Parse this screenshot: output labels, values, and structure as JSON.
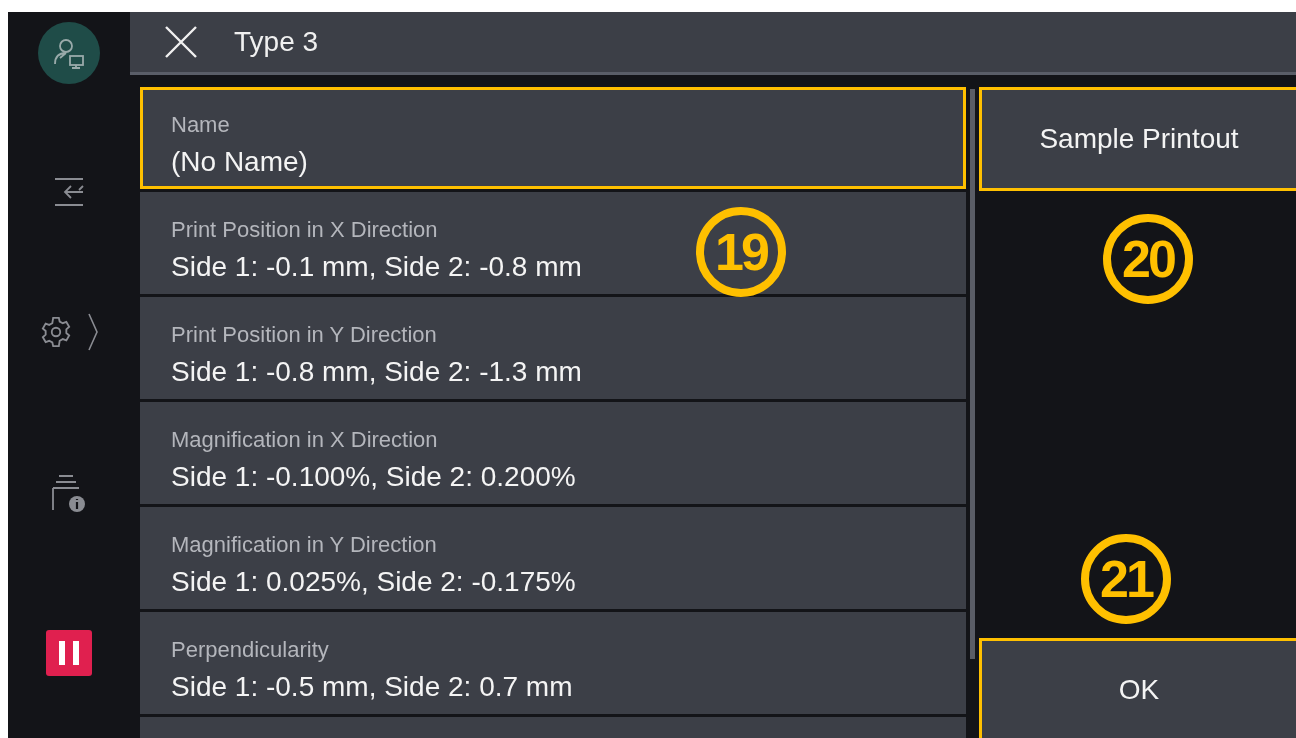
{
  "header": {
    "title": "Type 3"
  },
  "settings": [
    {
      "label": "Name",
      "value": "(No Name)",
      "highlighted": true
    },
    {
      "label": "Print Position in X Direction",
      "value": "Side 1: -0.1 mm, Side 2: -0.8 mm",
      "highlighted": false
    },
    {
      "label": "Print Position in Y Direction",
      "value": "Side 1: -0.8 mm, Side 2: -1.3 mm",
      "highlighted": false
    },
    {
      "label": "Magnification in X Direction",
      "value": "Side 1: -0.100%, Side 2: 0.200%",
      "highlighted": false
    },
    {
      "label": "Magnification in Y Direction",
      "value": "Side 1: 0.025%, Side 2: -0.175%",
      "highlighted": false
    },
    {
      "label": "Perpendicularity",
      "value": "Side 1: -0.5 mm, Side 2: 0.7 mm",
      "highlighted": false
    }
  ],
  "buttons": [
    {
      "label": "Sample Printout",
      "highlighted": true
    },
    {
      "label": "OK",
      "highlighted": true
    }
  ],
  "callouts": [
    "19",
    "20",
    "21"
  ]
}
